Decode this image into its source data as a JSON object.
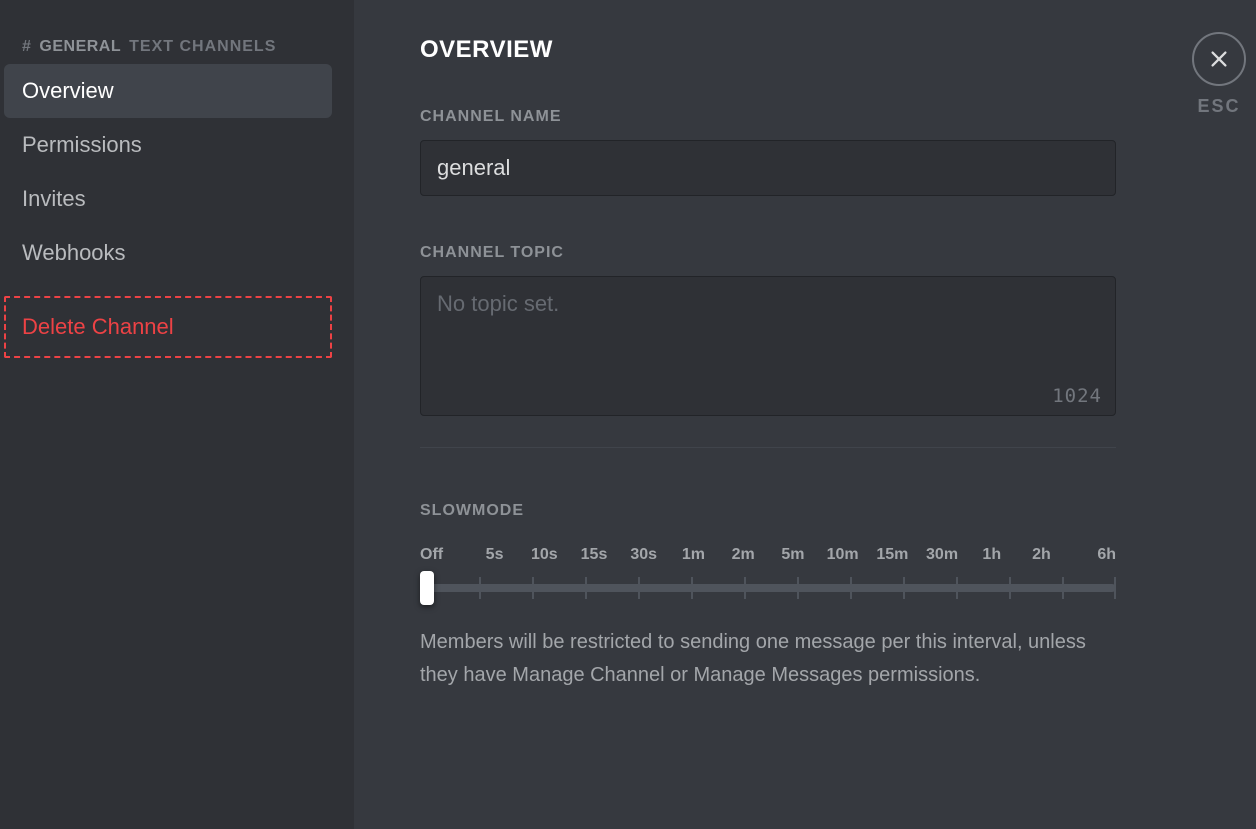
{
  "sidebar": {
    "hash": "#",
    "channel_name": "GENERAL",
    "category": "TEXT CHANNELS",
    "items": [
      {
        "label": "Overview",
        "selected": true
      },
      {
        "label": "Permissions",
        "selected": false
      },
      {
        "label": "Invites",
        "selected": false
      },
      {
        "label": "Webhooks",
        "selected": false
      }
    ],
    "delete_label": "Delete Channel"
  },
  "content": {
    "title": "OVERVIEW",
    "channel_name_label": "CHANNEL NAME",
    "channel_name_value": "general",
    "channel_topic_label": "CHANNEL TOPIC",
    "channel_topic_value": "",
    "channel_topic_placeholder": "No topic set.",
    "channel_topic_maxlen": "1024",
    "slowmode_label": "SLOWMODE",
    "slowmode_ticks": [
      "Off",
      "5s",
      "10s",
      "15s",
      "30s",
      "1m",
      "2m",
      "5m",
      "10m",
      "15m",
      "30m",
      "1h",
      "2h",
      "6h"
    ],
    "slowmode_desc": "Members will be restricted to sending one message per this interval, unless they have Manage Channel or Manage Messages permissions."
  },
  "close": {
    "label": "ESC"
  }
}
